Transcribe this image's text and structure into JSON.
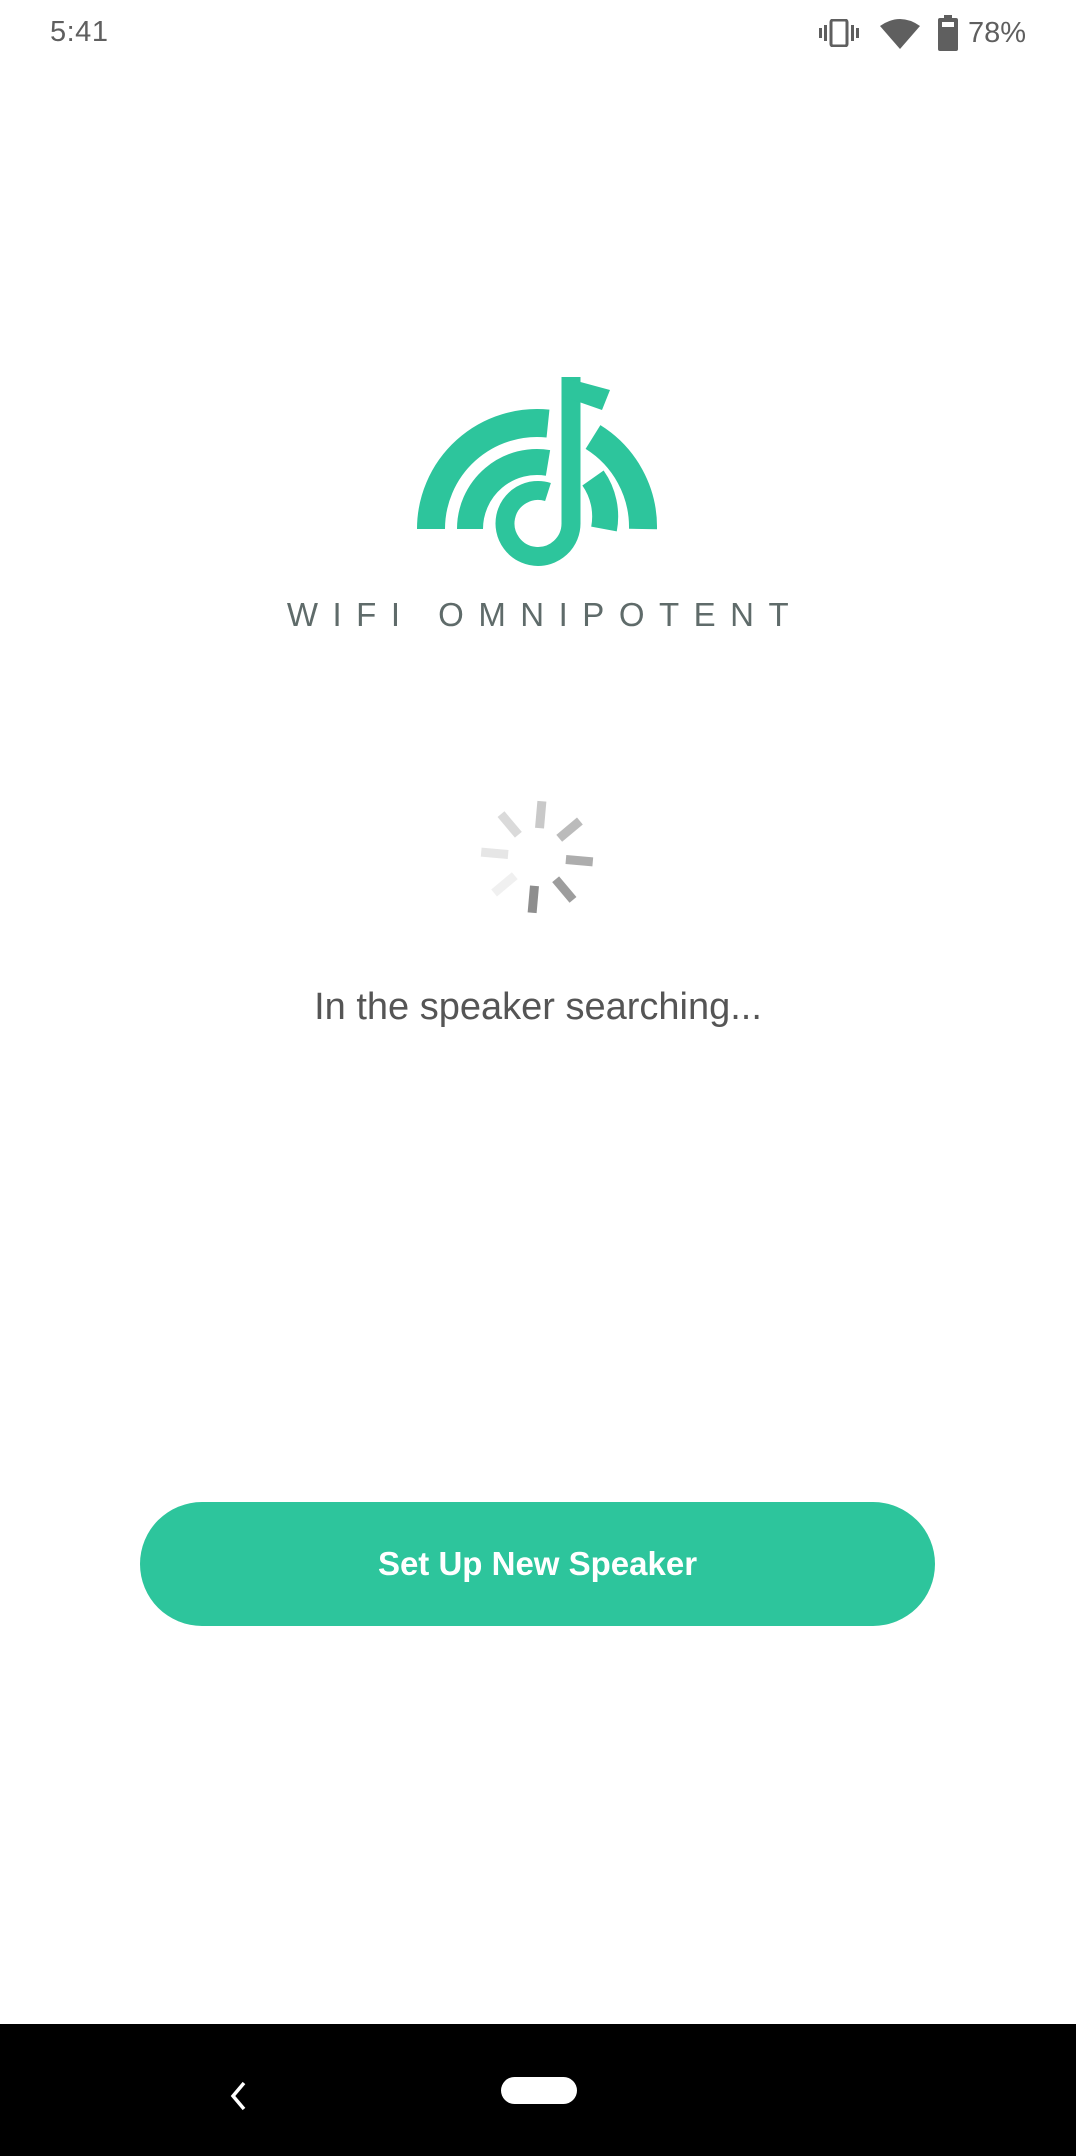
{
  "status_bar": {
    "time": "5:41",
    "icons": [
      "vibrate-icon",
      "wifi-icon",
      "battery-icon"
    ],
    "battery_percent": "78%",
    "battery_level": 0.78
  },
  "brand": {
    "name": "WIFI OMNIPOTENT",
    "logo_icon": "wifi-music-note-logo",
    "accent_color": "#2dc59c"
  },
  "main": {
    "loading_icon": "spinner-icon",
    "status_text": "In the speaker searching...",
    "setup_button_label": "Set Up New Speaker"
  },
  "nav_bar": {
    "back_icon": "back-icon",
    "home_icon": "home-pill-icon"
  }
}
